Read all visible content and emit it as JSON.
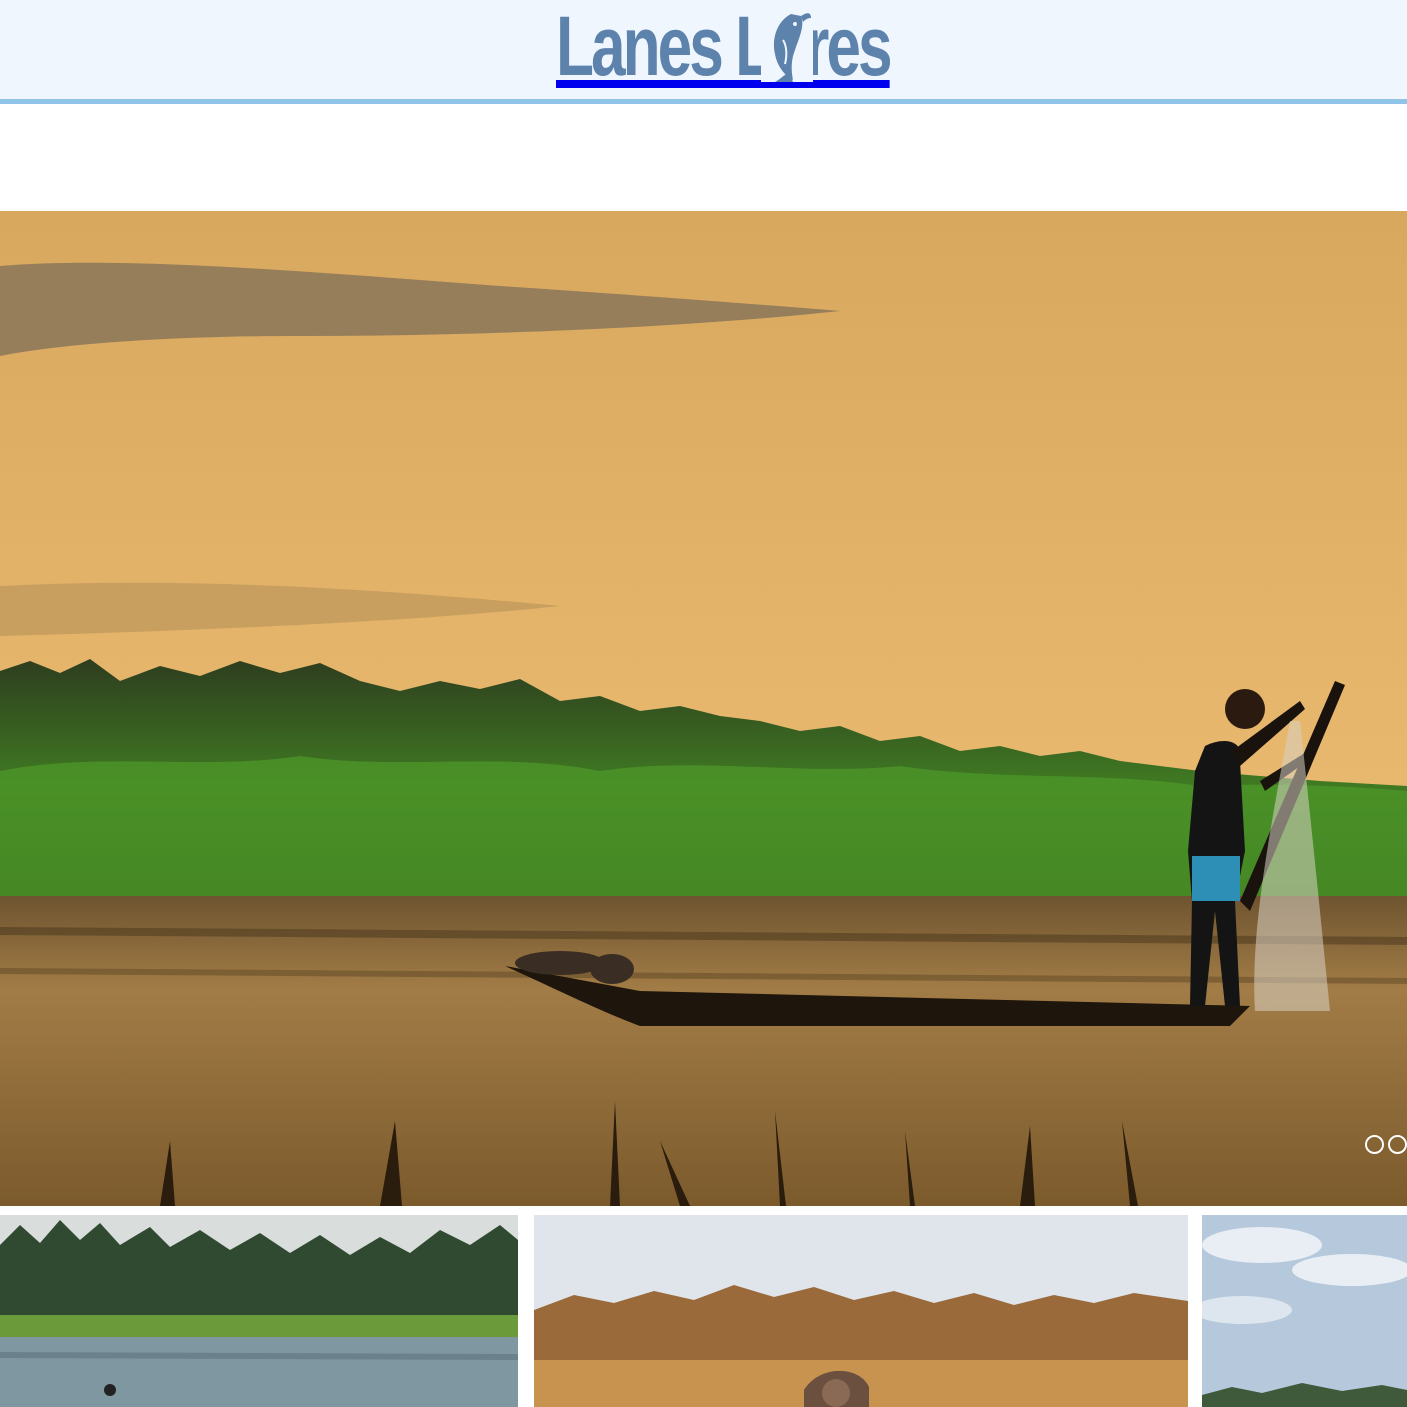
{
  "header": {
    "logo_text": "Lanes Lures",
    "logo_icon": "leaping-fish-icon"
  },
  "hero": {
    "image_label": "fisherman-casting-net-at-sunset",
    "slide_count": 2,
    "active_slide": 1
  },
  "gallery": {
    "items": [
      {
        "image_label": "misty-forest-lake-angler"
      },
      {
        "image_label": "fisherman-in-golden-reeds"
      },
      {
        "image_label": "cloudy-sky-shoreline"
      }
    ]
  },
  "colors": {
    "header_bg": "#eff6fe",
    "header_border": "#8fc4e8",
    "logo_blue": "#5d83ad"
  }
}
